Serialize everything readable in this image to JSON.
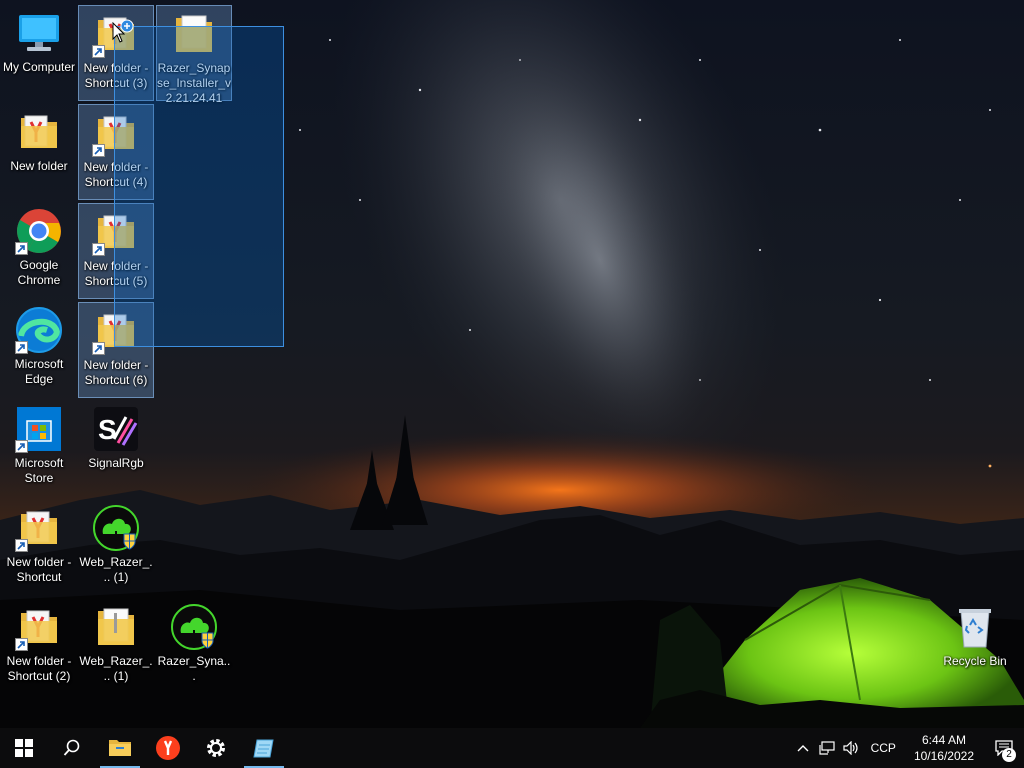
{
  "desktop": {
    "icons": [
      {
        "label": "My Computer"
      },
      {
        "label": "New folder"
      },
      {
        "label": "Google Chrome"
      },
      {
        "label": "Microsoft Edge"
      },
      {
        "label": "Microsoft Store"
      },
      {
        "label": "New folder - Shortcut"
      },
      {
        "label": "New folder - Shortcut (2)"
      },
      {
        "label": "New folder - Shortcut (3)"
      },
      {
        "label": "New folder - Shortcut (4)"
      },
      {
        "label": "New folder - Shortcut (5)"
      },
      {
        "label": "New folder - Shortcut (6)"
      },
      {
        "label": "SignalRgb"
      },
      {
        "label": "Web_Razer_... (1)"
      },
      {
        "label": "Web_Razer_... (1)"
      },
      {
        "label": "Razer_Synapse_Installer_v2.21.24.41"
      },
      {
        "label": "Razer_Syna..."
      },
      {
        "label": "Recycle Bin"
      }
    ]
  },
  "taskbar": {
    "pinned": [
      {
        "name": "start-button",
        "icon": "windows-logo-icon"
      },
      {
        "name": "search-button",
        "icon": "search-icon"
      },
      {
        "name": "file-explorer",
        "icon": "folder-icon"
      },
      {
        "name": "yandex-browser",
        "icon": "yandex-icon"
      },
      {
        "name": "settings",
        "icon": "gear-icon"
      },
      {
        "name": "notepad-window",
        "icon": "notepad-icon"
      }
    ],
    "language": "CCP",
    "time": "6:44 AM",
    "date": "10/16/2022",
    "notification_count": "2"
  },
  "colors": {
    "accent": "#76b9ed",
    "selection": "#3d8fe0",
    "tent": "#7cd81e"
  }
}
